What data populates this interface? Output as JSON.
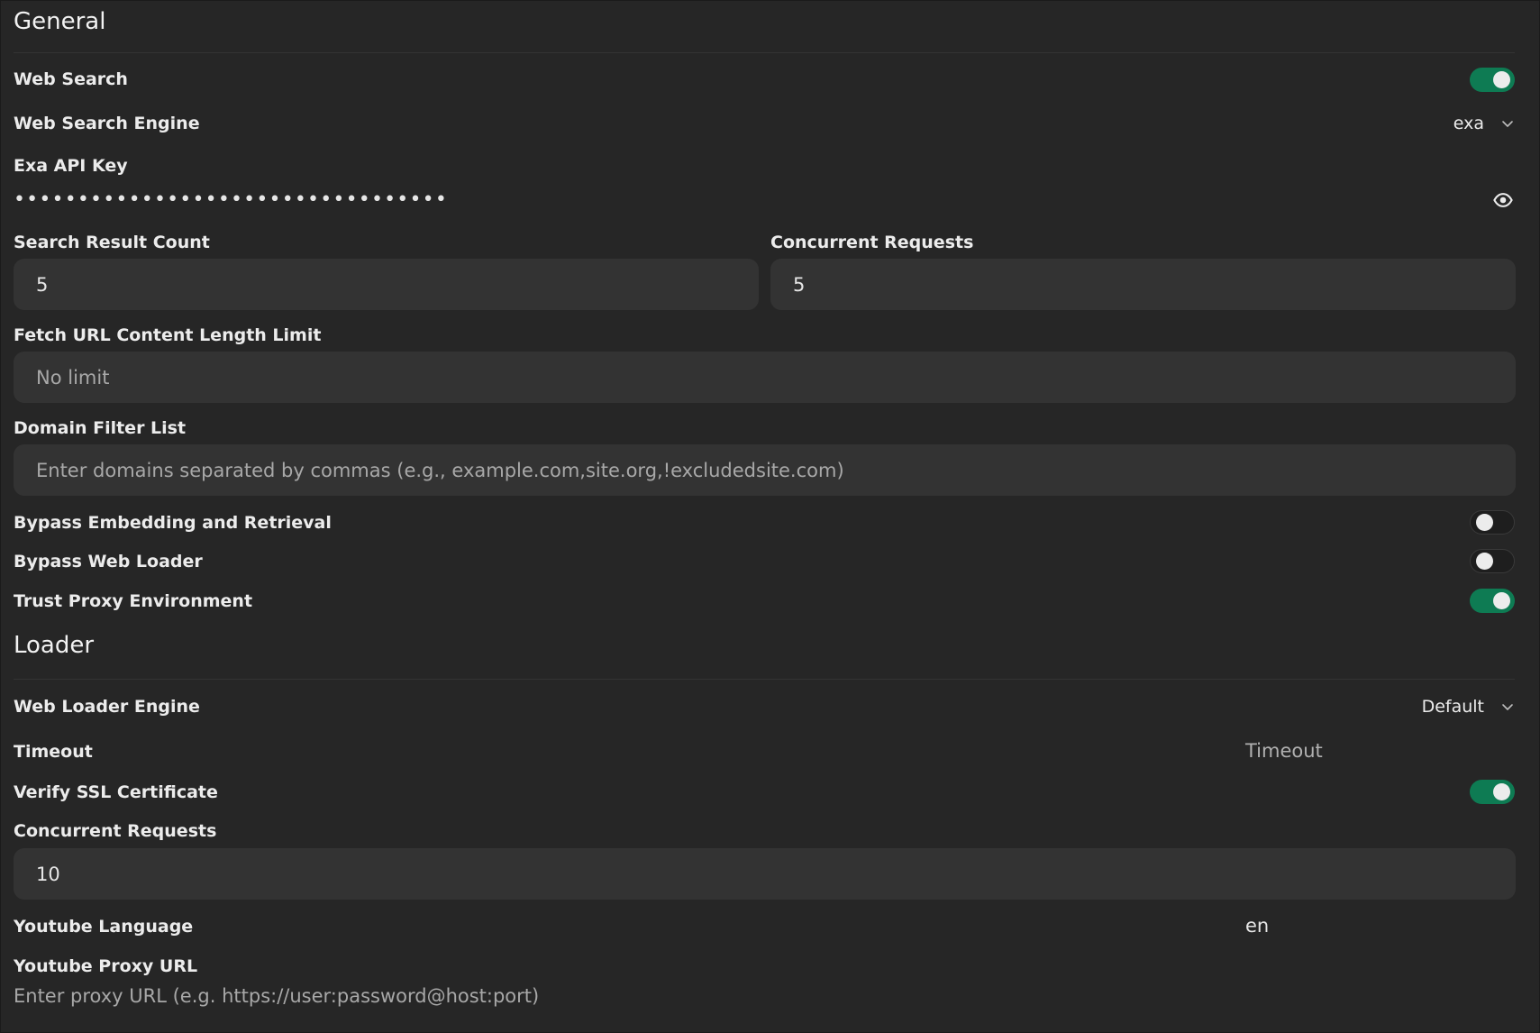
{
  "general": {
    "title": "General",
    "web_search": {
      "label": "Web Search",
      "enabled": true
    },
    "web_search_engine": {
      "label": "Web Search Engine",
      "value": "exa"
    },
    "exa_api_key": {
      "label": "Exa API Key",
      "masked_value": "••••••••••••••••••••••••••••••••••"
    },
    "search_result_count": {
      "label": "Search Result Count",
      "value": "5"
    },
    "concurrent_requests": {
      "label": "Concurrent Requests",
      "value": "5"
    },
    "fetch_url_limit": {
      "label": "Fetch URL Content Length Limit",
      "placeholder": "No limit"
    },
    "domain_filter": {
      "label": "Domain Filter List",
      "placeholder": "Enter domains separated by commas (e.g., example.com,site.org,!excludedsite.com)"
    },
    "bypass_embedding": {
      "label": "Bypass Embedding and Retrieval",
      "enabled": false
    },
    "bypass_web_loader": {
      "label": "Bypass Web Loader",
      "enabled": false
    },
    "trust_proxy": {
      "label": "Trust Proxy Environment",
      "enabled": true
    }
  },
  "loader": {
    "title": "Loader",
    "web_loader_engine": {
      "label": "Web Loader Engine",
      "value": "Default"
    },
    "timeout": {
      "label": "Timeout",
      "placeholder": "Timeout"
    },
    "verify_ssl": {
      "label": "Verify SSL Certificate",
      "enabled": true
    },
    "concurrent_requests": {
      "label": "Concurrent Requests",
      "value": "10"
    },
    "youtube_language": {
      "label": "Youtube Language",
      "value": "en"
    },
    "youtube_proxy": {
      "label": "Youtube Proxy URL",
      "placeholder": "Enter proxy URL (e.g. https://user:password@host:port)"
    }
  },
  "icons": {
    "eye": "eye-icon",
    "chevron": "chevron-down-icon"
  },
  "colors": {
    "background": "#262626",
    "input_background": "#333333",
    "toggle_on": "#0e7b53"
  }
}
